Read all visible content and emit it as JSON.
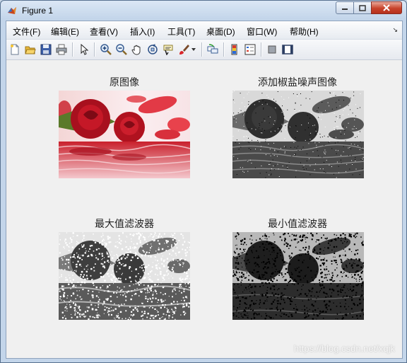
{
  "window": {
    "title": "Figure 1"
  },
  "menu": [
    {
      "label": "文件(F)",
      "name": "menu-file"
    },
    {
      "label": "编辑(E)",
      "name": "menu-edit"
    },
    {
      "label": "查看(V)",
      "name": "menu-view"
    },
    {
      "label": "插入(I)",
      "name": "menu-insert"
    },
    {
      "label": "工具(T)",
      "name": "menu-tools"
    },
    {
      "label": "桌面(D)",
      "name": "menu-desktop"
    },
    {
      "label": "窗口(W)",
      "name": "menu-window"
    },
    {
      "label": "帮助(H)",
      "name": "menu-help"
    }
  ],
  "toolbar": [
    "new-figure-icon",
    "open-file-icon",
    "save-icon",
    "print-icon",
    "select-arrow-icon",
    "zoom-in-icon",
    "zoom-out-icon",
    "pan-hand-icon",
    "rotate-3d-icon",
    "data-cursor-icon",
    "brush-icon",
    "link-plot-icon",
    "colorbar-icon",
    "legend-icon",
    "hide-plot-tools-icon",
    "show-plot-tools-icon"
  ],
  "subplots": [
    {
      "title": "原图像",
      "image": "color-rose"
    },
    {
      "title": "添加椒盐噪声图像",
      "image": "gray-rose-salt-pepper-noise"
    },
    {
      "title": "最大值滤波器",
      "image": "gray-rose-max-filtered"
    },
    {
      "title": "最小值滤波器",
      "image": "gray-rose-min-filtered"
    }
  ],
  "watermark": "https://blog.csdn.net/xqjk"
}
